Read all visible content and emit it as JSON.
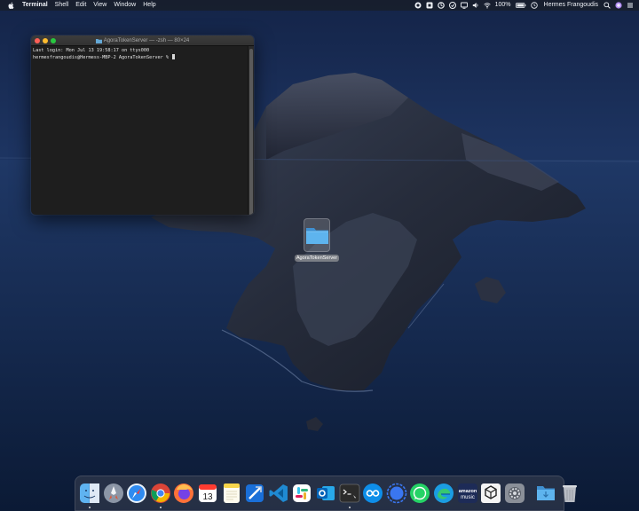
{
  "menubar": {
    "app_name": "Terminal",
    "menus": [
      "Shell",
      "Edit",
      "View",
      "Window",
      "Help"
    ],
    "battery_text": "100%",
    "user_name": "Hermes Frangoudis",
    "status_icons": [
      "record-icon",
      "dropbox-icon",
      "sync-icon",
      "app-status-icon",
      "screen-icon",
      "volume-icon",
      "wifi-icon",
      "battery-icon",
      "clock-icon",
      "search-icon",
      "siri-icon",
      "control-icon"
    ]
  },
  "terminal": {
    "title": "AgoraTokenServer — -zsh — 80×24",
    "lines": [
      "Last login: Mon Jul 13 19:58:17 on ttys000",
      "hermesfrangoudis@Hermess-MBP-2 AgoraTokenServer % "
    ]
  },
  "desktop": {
    "folder_label": "AgoraTokenServer"
  },
  "dock": {
    "apps": [
      {
        "name": "finder",
        "running": true
      },
      {
        "name": "launchpad",
        "running": false
      },
      {
        "name": "safari",
        "running": false
      },
      {
        "name": "chrome",
        "running": true
      },
      {
        "name": "firefox",
        "running": false
      },
      {
        "name": "calendar",
        "label": "13",
        "running": false
      },
      {
        "name": "notes",
        "running": false
      },
      {
        "name": "xcode",
        "running": false
      },
      {
        "name": "vscode",
        "running": false
      },
      {
        "name": "slack",
        "running": false
      },
      {
        "name": "outlook",
        "running": false
      },
      {
        "name": "terminal",
        "running": true
      },
      {
        "name": "teamviewer",
        "running": false
      },
      {
        "name": "signal",
        "running": false
      },
      {
        "name": "whatsapp",
        "running": false
      },
      {
        "name": "edge",
        "running": false
      },
      {
        "name": "amazon-music",
        "label": "amazon music",
        "running": false
      },
      {
        "name": "unity",
        "running": false
      },
      {
        "name": "system-preferences",
        "running": false
      },
      {
        "name": "downloads-folder",
        "running": false
      },
      {
        "name": "trash",
        "running": false
      }
    ]
  },
  "colors": {
    "menubar_bg": "#181e2c",
    "terminal_bg": "#1e1e1e",
    "close": "#fe5f57",
    "minimize": "#febc2e",
    "maximize": "#28c840"
  }
}
